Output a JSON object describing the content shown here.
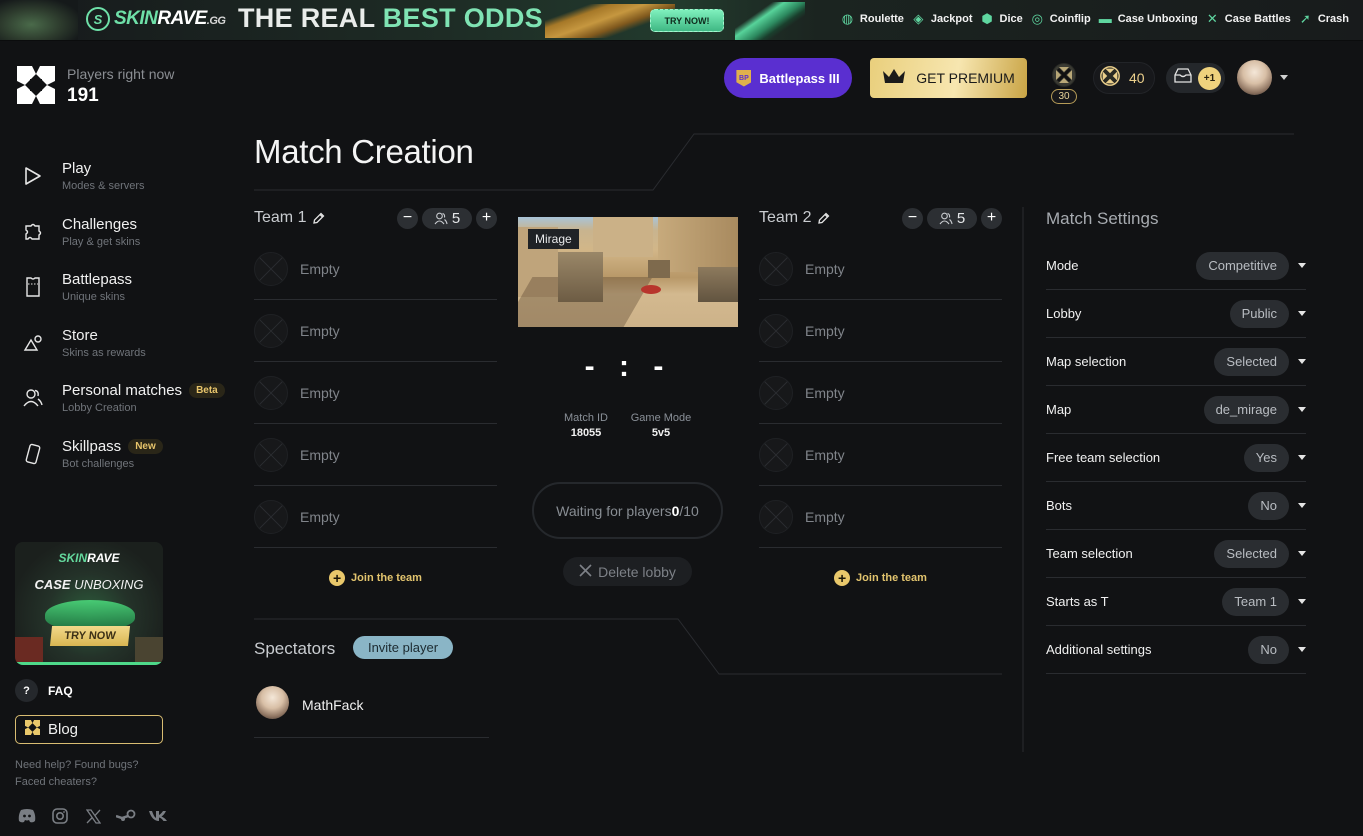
{
  "banner": {
    "brand_prefix": "SKIN",
    "brand_main": "RAVE",
    "brand_suffix": ".GG",
    "headline_white": "THE REAL ",
    "headline_green": "BEST ODDS",
    "cta": "TRY NOW!",
    "games": [
      {
        "label": "Roulette",
        "icon": "roulette-icon"
      },
      {
        "label": "Jackpot",
        "icon": "diamond-icon"
      },
      {
        "label": "Dice",
        "icon": "dice-icon"
      },
      {
        "label": "Coinflip",
        "icon": "coinflip-icon"
      },
      {
        "label": "Case Unboxing",
        "icon": "case-icon"
      },
      {
        "label": "Case Battles",
        "icon": "crossed-swords-icon"
      },
      {
        "label": "Crash",
        "icon": "rocket-icon"
      }
    ]
  },
  "sidebar": {
    "players_label": "Players right now",
    "players_count": "191",
    "nav": [
      {
        "label": "Play",
        "sub": "Modes & servers",
        "icon": "play-icon",
        "badge": null
      },
      {
        "label": "Challenges",
        "sub": "Play & get skins",
        "icon": "puzzle-icon",
        "badge": null
      },
      {
        "label": "Battlepass",
        "sub": "Unique skins",
        "icon": "ticket-icon",
        "badge": null
      },
      {
        "label": "Store",
        "sub": "Skins as rewards",
        "icon": "shapes-icon",
        "badge": null
      },
      {
        "label": "Personal matches",
        "sub": "Lobby Creation",
        "icon": "users-icon",
        "badge": "Beta"
      },
      {
        "label": "Skillpass",
        "sub": "Bot challenges",
        "icon": "card-icon",
        "badge": "New"
      }
    ],
    "promo": {
      "brand_prefix": "SKIN",
      "brand_main": "RAVE",
      "title_bold": "CASE",
      "title_rest": " UNBOXING",
      "cta": "TRY NOW"
    },
    "faq_label": "FAQ",
    "blog_label": "Blog",
    "help_text": "Need help? Found bugs? Faced cheaters?",
    "socials": [
      "discord-icon",
      "instagram-icon",
      "x-icon",
      "steam-icon",
      "vk-icon"
    ]
  },
  "header": {
    "battlepass_label": "Battlepass III",
    "battlepass_badge": "BP",
    "premium_label": "GET PREMIUM",
    "level": "30",
    "balance": "40",
    "inbox_count": "+1"
  },
  "main": {
    "title": "Match Creation",
    "teams": [
      {
        "name": "Team 1",
        "size": "5",
        "slots": [
          "Empty",
          "Empty",
          "Empty",
          "Empty",
          "Empty"
        ],
        "join_label": "Join the team"
      },
      {
        "name": "Team 2",
        "size": "5",
        "slots": [
          "Empty",
          "Empty",
          "Empty",
          "Empty",
          "Empty"
        ],
        "join_label": "Join the team"
      }
    ],
    "map_label": "Mirage",
    "score": "- : -",
    "match_id_label": "Match ID",
    "match_id": "18055",
    "game_mode_label": "Game Mode",
    "game_mode": "5v5",
    "waiting_prefix": "Waiting for players ",
    "waiting_current": "0",
    "waiting_total": "/10",
    "delete_label": "Delete lobby",
    "spectators_title": "Spectators",
    "invite_label": "Invite player",
    "spectators": [
      {
        "name": "MathFack"
      }
    ]
  },
  "settings": {
    "title": "Match Settings",
    "rows": [
      {
        "label": "Mode",
        "value": "Competitive"
      },
      {
        "label": "Lobby",
        "value": "Public"
      },
      {
        "label": "Map selection",
        "value": "Selected"
      },
      {
        "label": "Map",
        "value": "de_mirage"
      },
      {
        "label": "Free team selection",
        "value": "Yes"
      },
      {
        "label": "Bots",
        "value": "No"
      },
      {
        "label": "Team selection",
        "value": "Selected"
      },
      {
        "label": "Starts as T",
        "value": "Team 1"
      },
      {
        "label": "Additional settings",
        "value": "No"
      }
    ]
  },
  "colors": {
    "background": "#111214",
    "accent_gold": "#e9c86b",
    "battlepass_purple": "#5a2fd0",
    "invite_blue": "#8ab5c6",
    "banner_green": "#6ee0a8"
  }
}
